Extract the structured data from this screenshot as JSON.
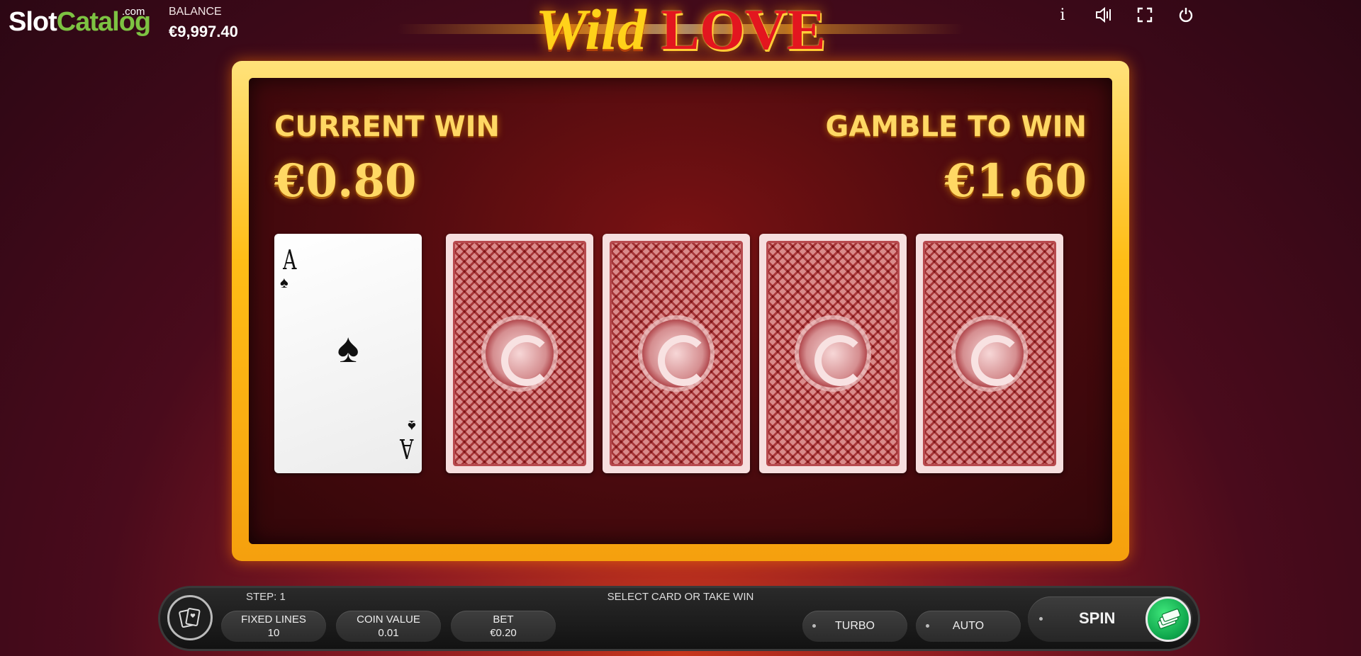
{
  "watermark": {
    "brand_part1": "Slot",
    "brand_part2": "Catalog",
    "brand_tld": ".com"
  },
  "balance": {
    "label": "BALANCE",
    "value": "€9,997.40"
  },
  "game_title": {
    "part1": "Wild",
    "part2": "LOVE"
  },
  "top_icons": [
    "info-icon",
    "sound-icon",
    "fullscreen-icon",
    "power-icon"
  ],
  "top_icon_labels": {
    "info": "i"
  },
  "gamble": {
    "current_win_label": "CURRENT WIN",
    "current_win_value": "€0.80",
    "gamble_to_win_label": "GAMBLE TO WIN",
    "gamble_to_win_value": "€1.60",
    "dealer_card": {
      "rank": "A",
      "suit": "♠"
    },
    "hidden_cards": 4
  },
  "bottom_bar": {
    "step_label": "STEP: 1",
    "message": "SELECT CARD OR TAKE WIN",
    "fixed_lines_label": "FIXED LINES",
    "fixed_lines_value": "10",
    "coin_value_label": "COIN VALUE",
    "coin_value_value": "0.01",
    "bet_label": "BET",
    "bet_value": "€0.20",
    "turbo_label": "TURBO",
    "auto_label": "AUTO",
    "spin_label": "SPIN"
  },
  "colors": {
    "gold": "#ffd864",
    "frame": "#ffbd16",
    "board": "#4a0a0e",
    "spin_green": "#0da34a",
    "brand_green": "#7dc242"
  }
}
